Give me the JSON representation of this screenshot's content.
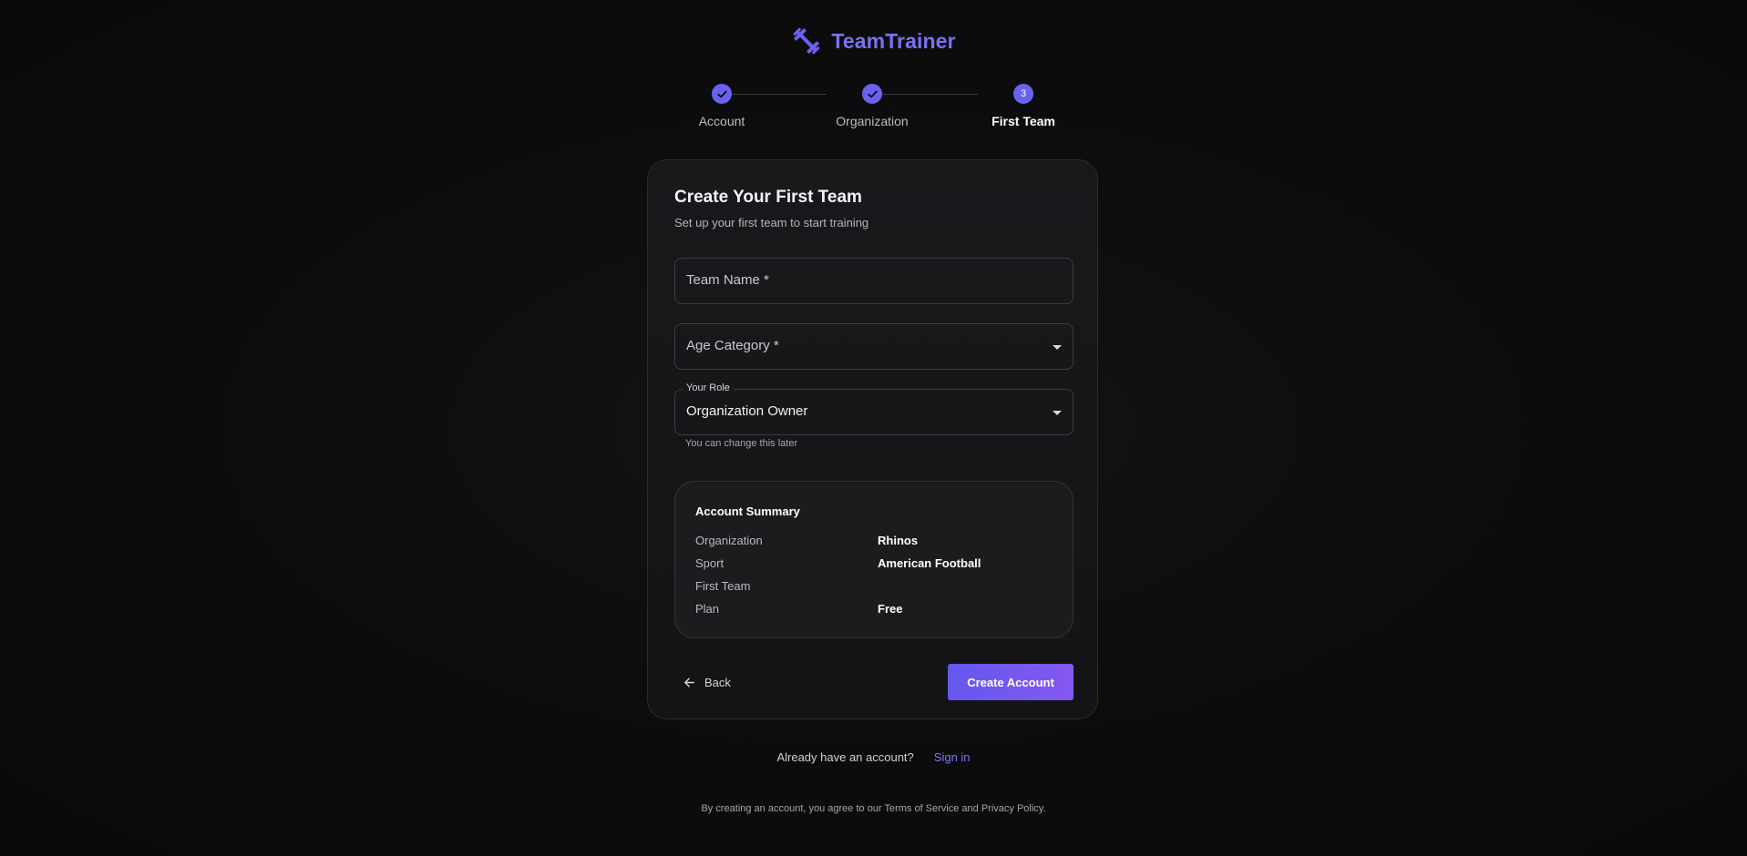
{
  "brand": {
    "name": "TeamTrainer",
    "icon": "dumbbell-icon",
    "accent": "#7b72f0"
  },
  "stepper": {
    "steps": [
      {
        "label": "Account",
        "state": "complete"
      },
      {
        "label": "Organization",
        "state": "complete"
      },
      {
        "label": "First Team",
        "state": "current",
        "number": "3"
      }
    ]
  },
  "form": {
    "title": "Create Your First Team",
    "subtitle": "Set up your first team to start training",
    "team_name": {
      "placeholder": "Team Name *",
      "value": ""
    },
    "age_category": {
      "placeholder": "Age Category *",
      "value": ""
    },
    "role": {
      "label": "Your Role",
      "value": "Organization Owner",
      "helper": "You can change this later"
    }
  },
  "summary": {
    "title": "Account Summary",
    "rows": [
      {
        "key": "Organization",
        "value": "Rhinos"
      },
      {
        "key": "Sport",
        "value": "American Football"
      },
      {
        "key": "First Team",
        "value": ""
      },
      {
        "key": "Plan",
        "value": "Free"
      }
    ]
  },
  "actions": {
    "back_label": "Back",
    "create_label": "Create Account",
    "button_gradient": [
      "#6458ee",
      "#8458f0"
    ]
  },
  "footer": {
    "prompt": "Already have an account?",
    "signin_label": "Sign in",
    "legal": "By creating an account, you agree to our Terms of Service and Privacy Policy."
  }
}
